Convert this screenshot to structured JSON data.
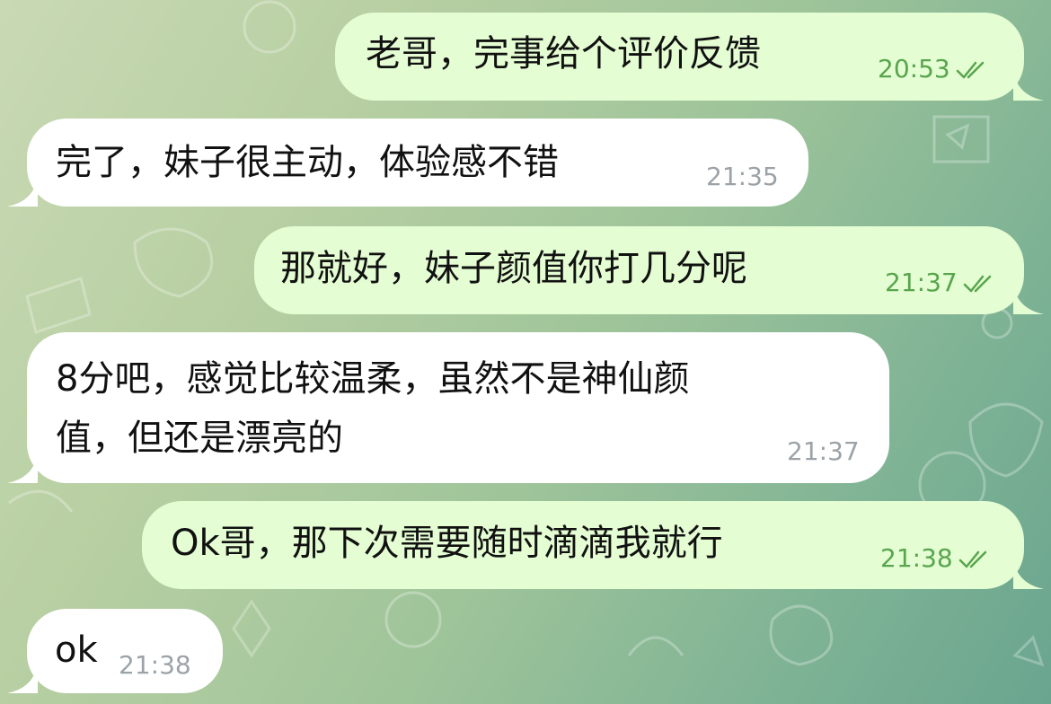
{
  "colors": {
    "outgoing_bubble": "#e4fdd3",
    "incoming_bubble": "#ffffff",
    "outgoing_meta": "#58a54d",
    "incoming_meta": "#9ba3a8"
  },
  "messages": [
    {
      "direction": "outgoing",
      "text": "老哥，完事给个评价反馈",
      "time": "20:53",
      "status_icon": "double-check-icon"
    },
    {
      "direction": "incoming",
      "text": "完了，妹子很主动，体验感不错",
      "time": "21:35"
    },
    {
      "direction": "outgoing",
      "text": "那就好，妹子颜值你打几分呢",
      "time": "21:37",
      "status_icon": "double-check-icon"
    },
    {
      "direction": "incoming",
      "text_line1": "8分吧，感觉比较温柔，虽然不是神仙颜",
      "text_line2": "值，但还是漂亮的",
      "time": "21:37"
    },
    {
      "direction": "outgoing",
      "text": "Ok哥，那下次需要随时滴滴我就行",
      "time": "21:38",
      "status_icon": "double-check-icon"
    },
    {
      "direction": "incoming",
      "text": "ok",
      "time": "21:38"
    }
  ]
}
